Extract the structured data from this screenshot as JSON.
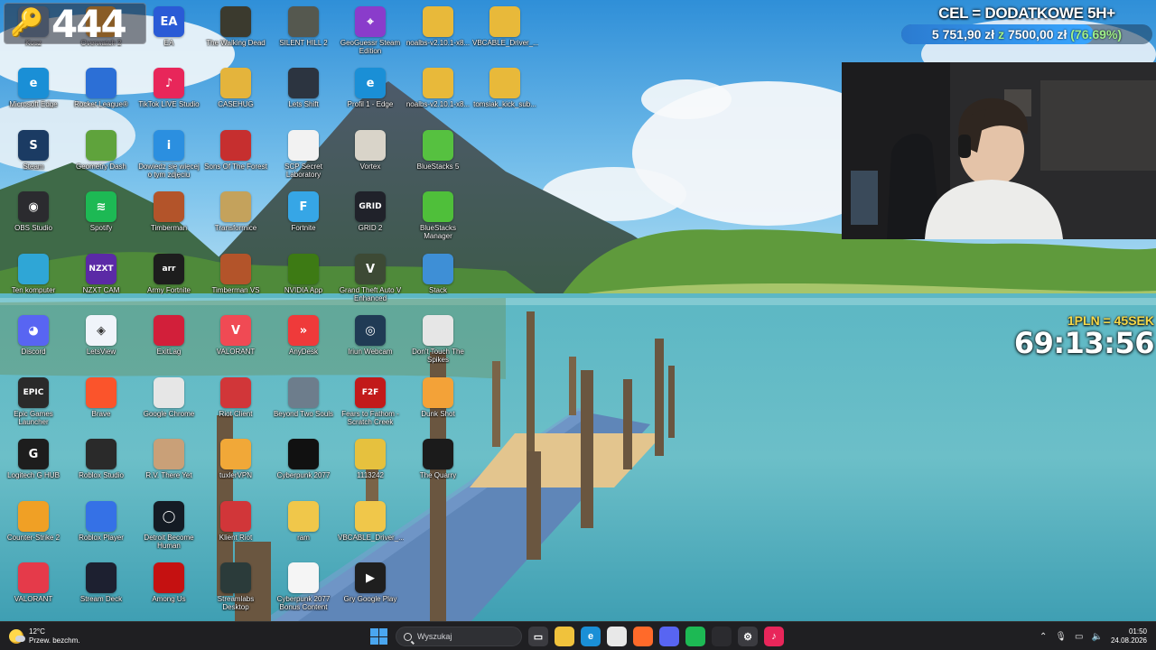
{
  "desktop": {
    "icons": [
      {
        "label": "Kosz",
        "glyph": "",
        "color": "#6f8aa8"
      },
      {
        "label": "Overwatch 2",
        "glyph": "",
        "color": "#ff9c1a"
      },
      {
        "label": "EA",
        "glyph": "EA",
        "color": "#2a5bd6"
      },
      {
        "label": "The Walking Dead",
        "glyph": "",
        "color": "#3b3a2e"
      },
      {
        "label": "SILENT HILL 2",
        "glyph": "",
        "color": "#55584f"
      },
      {
        "label": "GeoGuessr Steam Edition",
        "glyph": "⌖",
        "color": "#8a3ccb"
      },
      {
        "label": "noalbs-v2.10.1-x8...",
        "glyph": "",
        "color": "#e8b93a"
      },
      {
        "label": "VBCABLE_Driver_...",
        "glyph": "",
        "color": "#e8b93a"
      },
      {
        "label": "Microsoft Edge",
        "glyph": "e",
        "color": "#1a8fd6"
      },
      {
        "label": "Rocket League®",
        "glyph": "",
        "color": "#2c6fd6"
      },
      {
        "label": "TikTok LIVE Studio",
        "glyph": "♪",
        "color": "#e8265a"
      },
      {
        "label": "CASEHUG",
        "glyph": "",
        "color": "#e4b43c"
      },
      {
        "label": "Lets Shift",
        "glyph": "",
        "color": "#2c3440"
      },
      {
        "label": "Profil 1 - Edge",
        "glyph": "e",
        "color": "#1a8fd6"
      },
      {
        "label": "noalbs-v2.10.1-x8...",
        "glyph": "",
        "color": "#e8b93a"
      },
      {
        "label": "tomsiak_kick_sub...",
        "glyph": "",
        "color": "#e8b93a"
      },
      {
        "label": "Steam",
        "glyph": "S",
        "color": "#1b3b63"
      },
      {
        "label": "Geometry Dash",
        "glyph": "",
        "color": "#5fa33c"
      },
      {
        "label": "Dowiedz się więcej o tym zdjęciu",
        "glyph": "i",
        "color": "#2b8fe0"
      },
      {
        "label": "Sons Of The Forest",
        "glyph": "",
        "color": "#c62f2f"
      },
      {
        "label": "SCP Secret Laboratory",
        "glyph": "",
        "color": "#f2f2f2"
      },
      {
        "label": "Vortex",
        "glyph": "",
        "color": "#d9d4c9"
      },
      {
        "label": "BlueStacks 5",
        "glyph": "",
        "color": "#56c140"
      },
      {
        "label": "OBS Studio",
        "glyph": "◉",
        "color": "#2b2b2f"
      },
      {
        "label": "Spotify",
        "glyph": "≋",
        "color": "#1db954"
      },
      {
        "label": "Timberman",
        "glyph": "",
        "color": "#b3542a"
      },
      {
        "label": "Transformice",
        "glyph": "",
        "color": "#c4a25c"
      },
      {
        "label": "Fortnite",
        "glyph": "F",
        "color": "#36a6e6"
      },
      {
        "label": "GRID 2",
        "glyph": "GRID",
        "color": "#20222a"
      },
      {
        "label": "BlueStacks Manager",
        "glyph": "",
        "color": "#4fbf3a"
      },
      {
        "label": "Ten komputer",
        "glyph": "",
        "color": "#2fa6d6"
      },
      {
        "label": "NZXT CAM",
        "glyph": "NZXT",
        "color": "#5b2aa6"
      },
      {
        "label": "Army Fortnite",
        "glyph": "arr",
        "color": "#1d1d1d"
      },
      {
        "label": "Timberman VS",
        "glyph": "",
        "color": "#b3542a"
      },
      {
        "label": "NVIDIA App",
        "glyph": "",
        "color": "#3d7a14"
      },
      {
        "label": "Grand Theft Auto V Enhanced",
        "glyph": "V",
        "color": "#3d4a35"
      },
      {
        "label": "Stack",
        "glyph": "",
        "color": "#3e8fd6"
      },
      {
        "label": "Discord",
        "glyph": "◕",
        "color": "#5865f2"
      },
      {
        "label": "LetsView",
        "glyph": "◈",
        "color": "#f0f4fa"
      },
      {
        "label": "ExitLag",
        "glyph": "",
        "color": "#d21f3a"
      },
      {
        "label": "VALORANT",
        "glyph": "V",
        "color": "#f04a54"
      },
      {
        "label": "AnyDesk",
        "glyph": "»",
        "color": "#ef3a3a"
      },
      {
        "label": "Iriun Webcam",
        "glyph": "◎",
        "color": "#203b55"
      },
      {
        "label": "Don't Touch The Spikes",
        "glyph": "",
        "color": "#e6e6e6"
      },
      {
        "label": "Epic Games Launcher",
        "glyph": "EPIC",
        "color": "#2a2a2a"
      },
      {
        "label": "Brave",
        "glyph": "",
        "color": "#fb542b"
      },
      {
        "label": "Google Chrome",
        "glyph": "",
        "color": "#e6e6e6"
      },
      {
        "label": "Riot Client",
        "glyph": "",
        "color": "#d13639"
      },
      {
        "label": "Beyond Two Souls",
        "glyph": "",
        "color": "#6d7d8c"
      },
      {
        "label": "Fears to Fathom - Scratch Creek",
        "glyph": "F2F",
        "color": "#c21a1a"
      },
      {
        "label": "Dunk Shot",
        "glyph": "",
        "color": "#f3a238"
      },
      {
        "label": "Logitech G HUB",
        "glyph": "G",
        "color": "#1d1d1d"
      },
      {
        "label": "Roblox Studio",
        "glyph": "",
        "color": "#2a2a2a"
      },
      {
        "label": "R.V. There Yet",
        "glyph": "",
        "color": "#c9a078"
      },
      {
        "label": "tuxlerVPN",
        "glyph": "",
        "color": "#f1a838"
      },
      {
        "label": "Cyberpunk 2077",
        "glyph": "",
        "color": "#111111"
      },
      {
        "label": "1113242",
        "glyph": "",
        "color": "#e6c13e"
      },
      {
        "label": "The Quarry",
        "glyph": "",
        "color": "#1b1b1b"
      },
      {
        "label": "Counter-Strike 2",
        "glyph": "",
        "color": "#f0a025"
      },
      {
        "label": "Roblox Player",
        "glyph": "",
        "color": "#3571e6"
      },
      {
        "label": "Detroit Become Human",
        "glyph": "◯",
        "color": "#141b24"
      },
      {
        "label": "Klient Riot",
        "glyph": "",
        "color": "#d13639"
      },
      {
        "label": "ram",
        "glyph": "",
        "color": "#f0c74a"
      },
      {
        "label": "VBCABLE_Driver_...",
        "glyph": "",
        "color": "#f0c74a"
      },
      {
        "label": "VALORANT",
        "glyph": "",
        "color": "#e53a4a"
      },
      {
        "label": "Stream Deck",
        "glyph": "",
        "color": "#1d2030"
      },
      {
        "label": "Among Us",
        "glyph": "",
        "color": "#c51111"
      },
      {
        "label": "Streamlabs Desktop",
        "glyph": "",
        "color": "#2b3b3a"
      },
      {
        "label": "Cyberpunk 2077 Bonus Content",
        "glyph": "",
        "color": "#f5f5f5"
      },
      {
        "label": "Gry Google Play",
        "glyph": "▶",
        "color": "#1f1f1f"
      }
    ]
  },
  "overlay": {
    "counter": "444",
    "goal_title": "CEL = DODATKOWE 5H+",
    "goal_current": "5 751,90 zł",
    "goal_sep": "z",
    "goal_target": "7500,00 zł",
    "goal_percent": "(76.69%)",
    "goal_fraction": 0.7669,
    "timer_rate": "1PLN = 45SEK",
    "timer_clock": "69:13:56"
  },
  "taskbar": {
    "weather_temp": "12°C",
    "weather_desc": "Przew. bezchm.",
    "search_placeholder": "Wyszukaj",
    "pinned": [
      {
        "name": "task-view",
        "glyph": "▭",
        "color": "#3b3b40"
      },
      {
        "name": "file-explorer",
        "glyph": "",
        "color": "#f0c23c"
      },
      {
        "name": "edge",
        "glyph": "e",
        "color": "#1a8fd6"
      },
      {
        "name": "store",
        "glyph": "",
        "color": "#e8e8e8"
      },
      {
        "name": "firefox",
        "glyph": "",
        "color": "#ff6a2a"
      },
      {
        "name": "discord",
        "glyph": "",
        "color": "#5865f2"
      },
      {
        "name": "spotify",
        "glyph": "",
        "color": "#1db954"
      },
      {
        "name": "obs",
        "glyph": "",
        "color": "#2b2b2f"
      },
      {
        "name": "settings",
        "glyph": "⚙",
        "color": "#3b3b40"
      },
      {
        "name": "tiktok-live",
        "glyph": "♪",
        "color": "#e8265a"
      }
    ],
    "time": "01:50",
    "date": "24.08.2026"
  }
}
